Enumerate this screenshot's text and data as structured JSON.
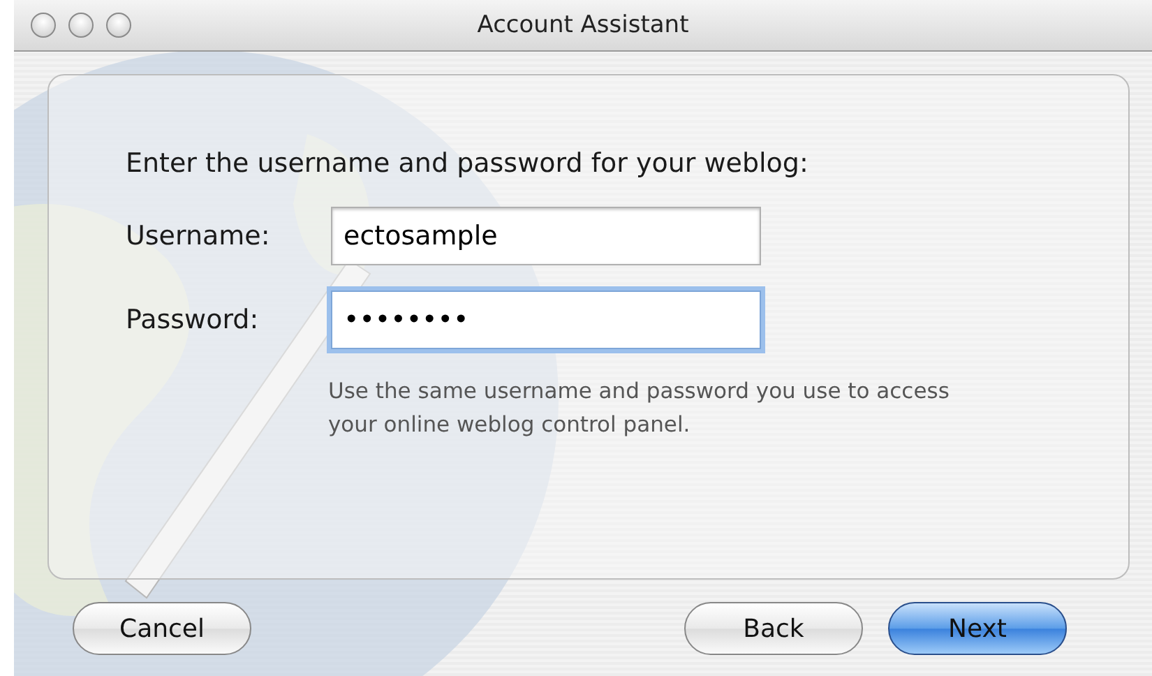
{
  "window": {
    "title": "Account Assistant"
  },
  "prompt": "Enter the username and password for your weblog:",
  "fields": [
    {
      "label": "Username:",
      "value": "ectosample",
      "focused": false
    },
    {
      "label": "Password:",
      "value": "••••••••",
      "focused": true
    }
  ],
  "hint": "Use the same username and password you use to access your online weblog control panel.",
  "buttons": [
    {
      "label": "Cancel",
      "default": false
    },
    {
      "label": "Back",
      "default": false
    },
    {
      "label": "Next",
      "default": true
    }
  ]
}
